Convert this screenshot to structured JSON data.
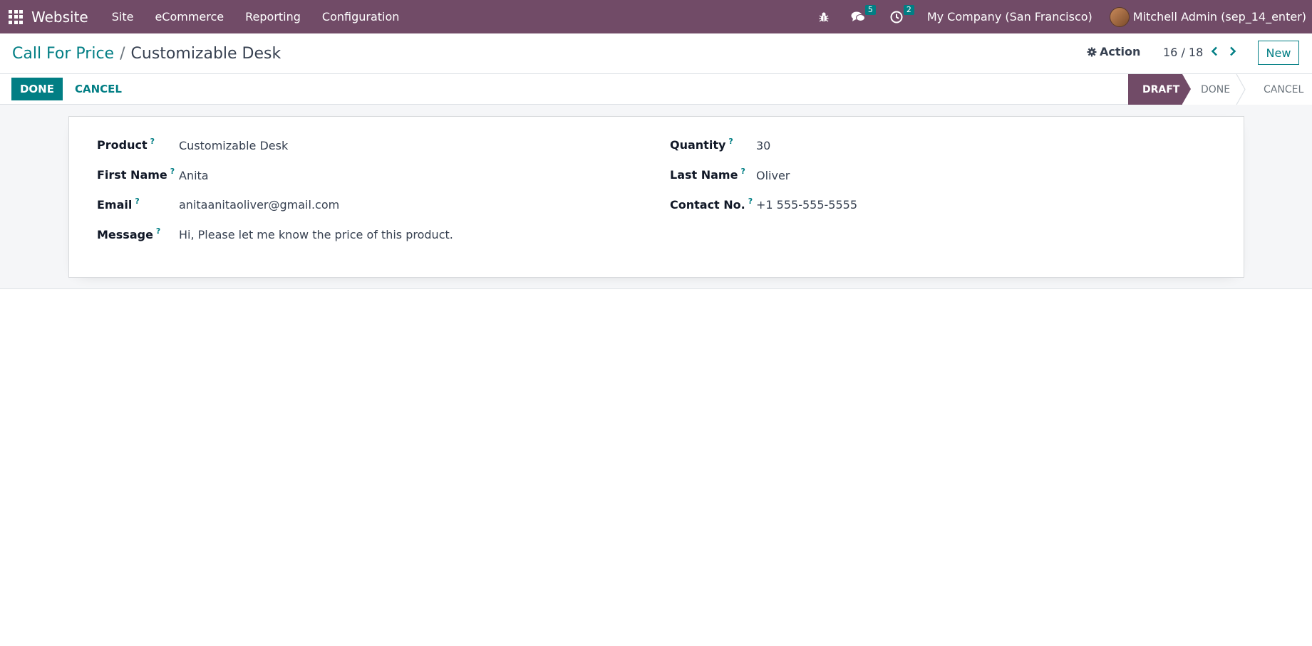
{
  "navbar": {
    "app_name": "Website",
    "menu": [
      "Site",
      "eCommerce",
      "Reporting",
      "Configuration"
    ],
    "messages_count": "5",
    "activities_count": "2",
    "company": "My Company (San Francisco)",
    "user": "Mitchell Admin (sep_14_enter)",
    "icons": [
      "apps-grid-icon",
      "bug-icon",
      "chat-icon",
      "clock-icon"
    ]
  },
  "control": {
    "breadcrumb_parent": "Call For Price",
    "breadcrumb_sep": "/",
    "breadcrumb_current": "Customizable Desk",
    "action_label": "Action",
    "pager": "16 / 18",
    "new_label": "New"
  },
  "statusbar": {
    "done_label": "DONE",
    "cancel_label": "CANCEL",
    "stages": [
      "DRAFT",
      "DONE",
      "CANCEL"
    ],
    "active_stage": "DRAFT"
  },
  "form": {
    "left": [
      {
        "label": "Product",
        "value": "Customizable Desk"
      },
      {
        "label": "First Name",
        "value": "Anita"
      },
      {
        "label": "Email",
        "value": "anitaanitaoliver@gmail.com"
      },
      {
        "label": "Message",
        "value": "Hi, Please let me know the price of this product."
      }
    ],
    "right": [
      {
        "label": "Quantity",
        "value": "30"
      },
      {
        "label": "Last Name",
        "value": "Oliver"
      },
      {
        "label": "Contact No.",
        "value": "+1 555-555-5555"
      }
    ],
    "help_mark": "?"
  },
  "colors": {
    "brand": "#714B67",
    "accent": "#017E84"
  }
}
